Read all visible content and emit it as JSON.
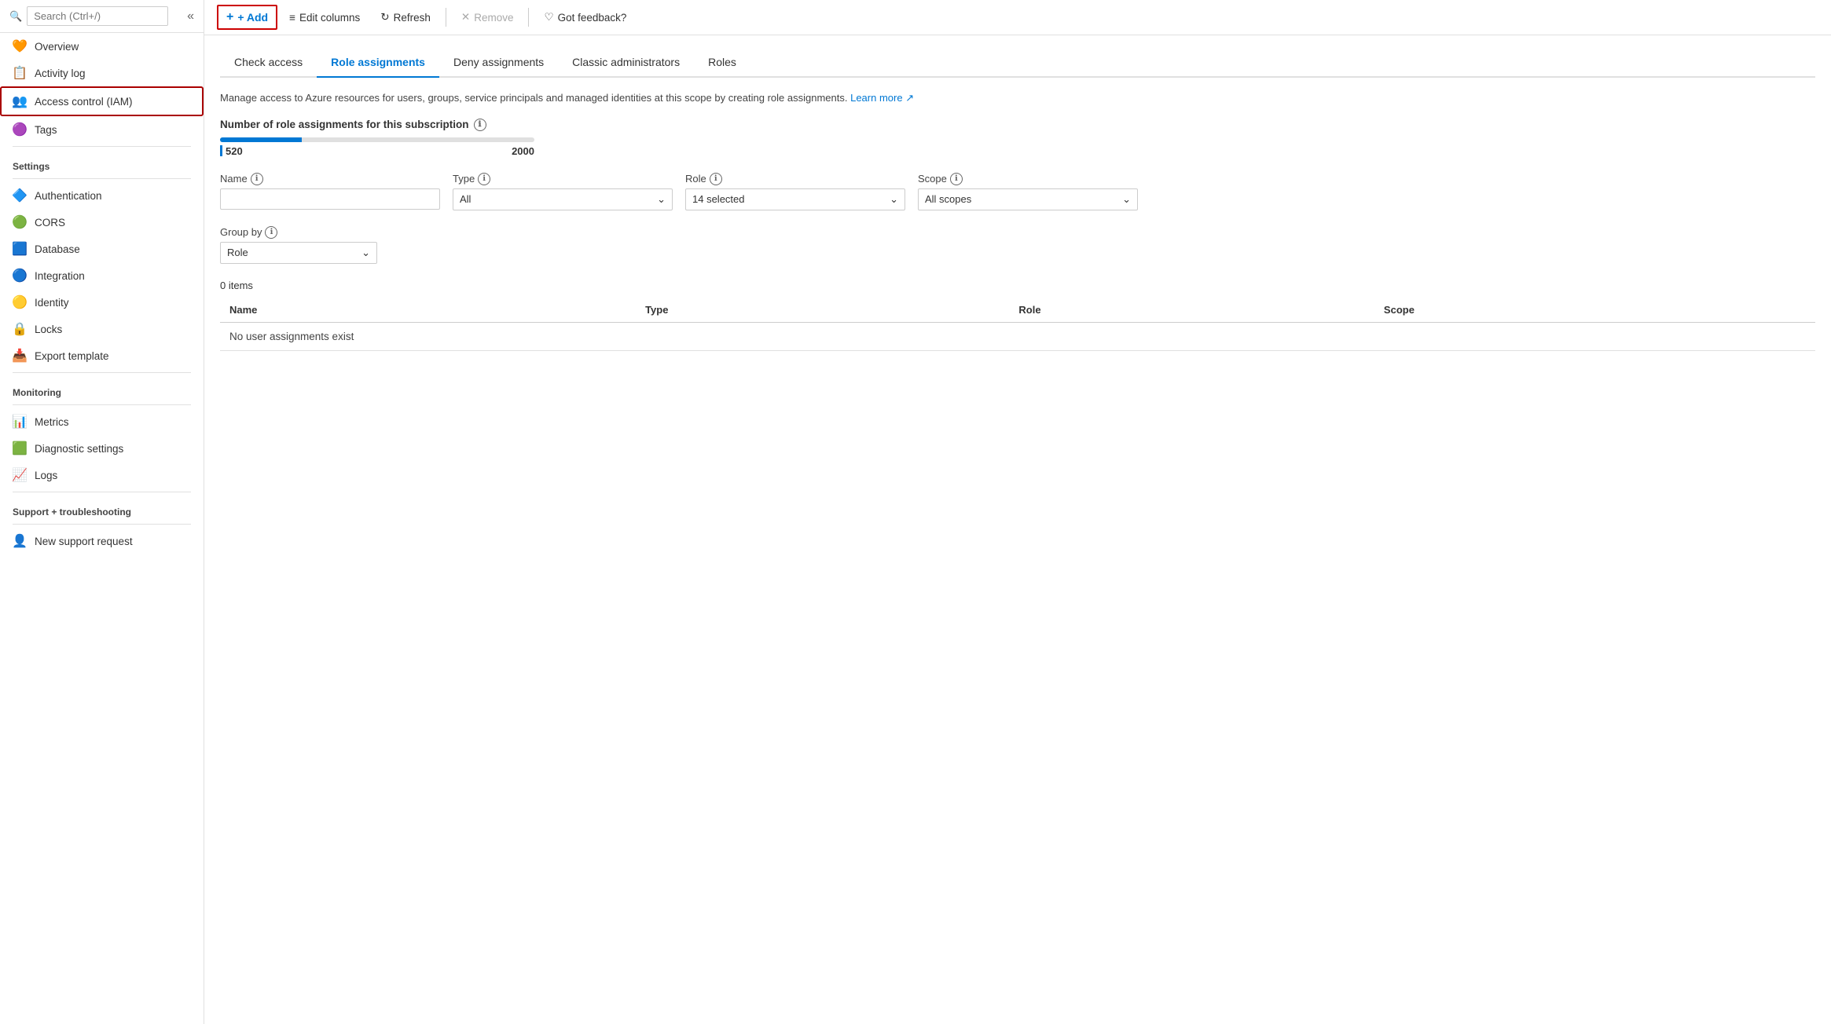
{
  "sidebar": {
    "search_placeholder": "Search (Ctrl+/)",
    "collapse_icon": "«",
    "items": [
      {
        "id": "overview",
        "label": "Overview",
        "icon": "🧡",
        "active": false
      },
      {
        "id": "activity-log",
        "label": "Activity log",
        "icon": "📋",
        "active": false
      },
      {
        "id": "access-control",
        "label": "Access control (IAM)",
        "icon": "👥",
        "active": true
      }
    ],
    "tags": {
      "id": "tags",
      "label": "Tags",
      "icon": "🟣"
    },
    "settings_label": "Settings",
    "settings_items": [
      {
        "id": "authentication",
        "label": "Authentication",
        "icon": "🔷"
      },
      {
        "id": "cors",
        "label": "CORS",
        "icon": "🟢"
      },
      {
        "id": "database",
        "label": "Database",
        "icon": "🟦"
      },
      {
        "id": "integration",
        "label": "Integration",
        "icon": "🔵"
      },
      {
        "id": "identity",
        "label": "Identity",
        "icon": "🟡"
      },
      {
        "id": "locks",
        "label": "Locks",
        "icon": "🔒"
      },
      {
        "id": "export-template",
        "label": "Export template",
        "icon": "📥"
      }
    ],
    "monitoring_label": "Monitoring",
    "monitoring_items": [
      {
        "id": "metrics",
        "label": "Metrics",
        "icon": "📊"
      },
      {
        "id": "diagnostic-settings",
        "label": "Diagnostic settings",
        "icon": "🟩"
      },
      {
        "id": "logs",
        "label": "Logs",
        "icon": "📈"
      }
    ],
    "support_label": "Support + troubleshooting",
    "support_items": [
      {
        "id": "new-support-request",
        "label": "New support request",
        "icon": "👤"
      }
    ]
  },
  "toolbar": {
    "add_label": "+ Add",
    "edit_columns_label": "Edit columns",
    "refresh_label": "Refresh",
    "remove_label": "Remove",
    "feedback_label": "Got feedback?"
  },
  "tabs": [
    {
      "id": "check-access",
      "label": "Check access",
      "active": false
    },
    {
      "id": "role-assignments",
      "label": "Role assignments",
      "active": true
    },
    {
      "id": "deny-assignments",
      "label": "Deny assignments",
      "active": false
    },
    {
      "id": "classic-administrators",
      "label": "Classic administrators",
      "active": false
    },
    {
      "id": "roles",
      "label": "Roles",
      "active": false
    }
  ],
  "content": {
    "description": "Manage access to Azure resources for users, groups, service principals and managed identities at this scope by creating role assignments.",
    "learn_more": "Learn more",
    "progress_title": "Number of role assignments for this subscription",
    "progress_value": "520",
    "progress_max": "2000",
    "progress_percent": 26,
    "filters": {
      "name_label": "Name",
      "name_placeholder": "",
      "type_label": "Type",
      "type_value": "All",
      "role_label": "Role",
      "role_value": "14 selected",
      "scope_label": "Scope",
      "scope_value": "All scopes",
      "group_by_label": "Group by",
      "group_by_value": "Role"
    },
    "items_count": "0 items",
    "table": {
      "columns": [
        "Name",
        "Type",
        "Role",
        "Scope"
      ],
      "empty_message": "No user assignments exist"
    }
  }
}
